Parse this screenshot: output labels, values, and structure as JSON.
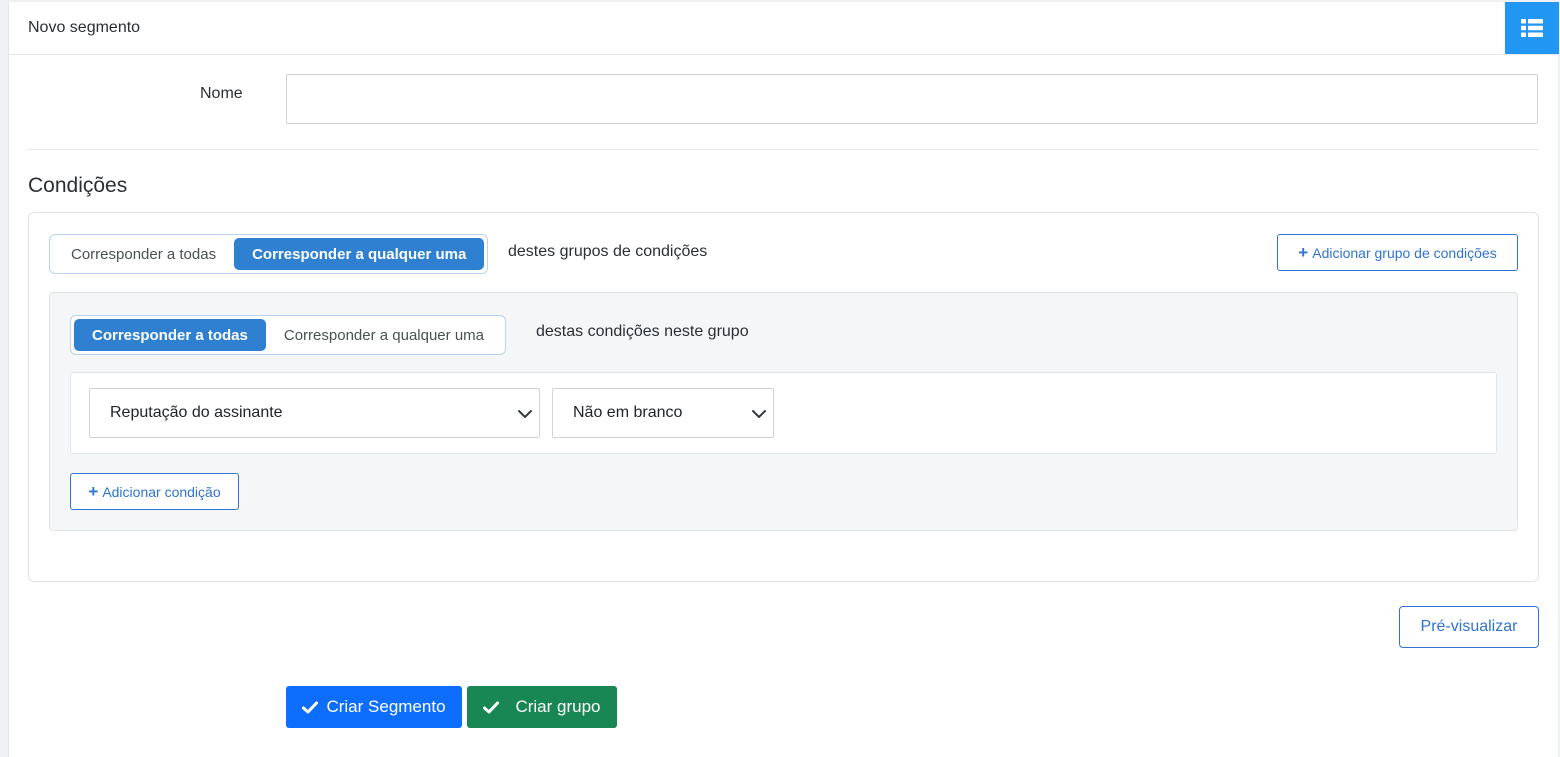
{
  "header": {
    "title": "Novo segmento",
    "menu_icon": "list-icon",
    "accent_color": "#2196f3"
  },
  "form": {
    "name_label": "Nome",
    "name_value": "",
    "name_placeholder": ""
  },
  "conditions": {
    "title": "Condições",
    "match_toggle": {
      "options": [
        "Corresponder a todas",
        "Corresponder a qualquer uma"
      ],
      "selected": "Corresponder a qualquer uma"
    },
    "match_suffix": "destes grupos de condições",
    "add_group_label": "Adicionar grupo de condições",
    "group": {
      "match_toggle": {
        "options": [
          "Corresponder a todas",
          "Corresponder a qualquer uma"
        ],
        "selected": "Corresponder a todas"
      },
      "match_suffix": "destas condições neste grupo",
      "condition": {
        "field_value": "Reputação do assinante",
        "operator_value": "Não em branco"
      },
      "add_condition_label": "Adicionar condição"
    }
  },
  "actions": {
    "preview_label": "Pré-visualizar",
    "create_segment_label": "Criar Segmento",
    "create_group_label": "Criar grupo",
    "create_segment_color": "#0d6efd",
    "create_group_color": "#198754"
  }
}
